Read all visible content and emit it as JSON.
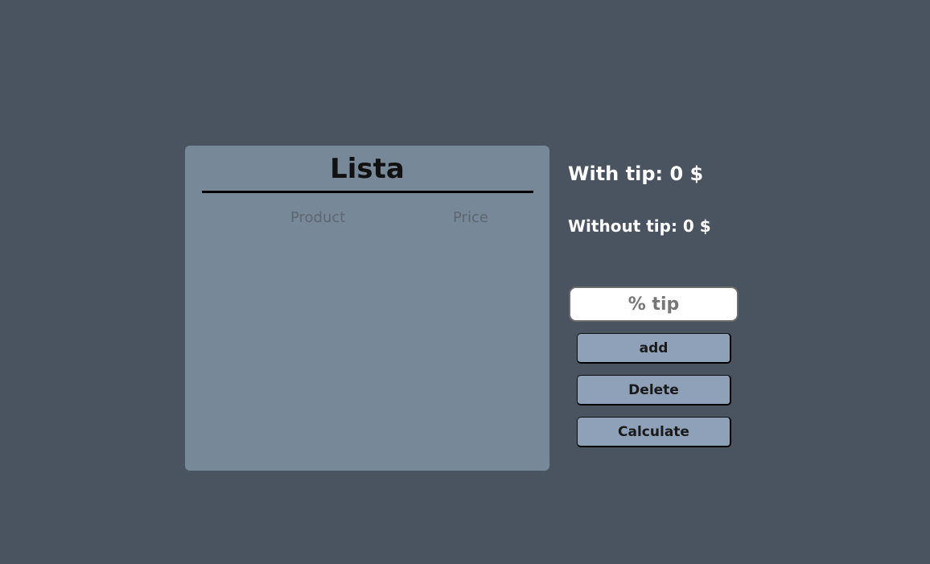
{
  "list": {
    "title": "Lista",
    "columns": {
      "product": "Product",
      "price": "Price"
    }
  },
  "totals": {
    "with_tip": "With tip: 0 $",
    "without_tip": "Without tip: 0 $"
  },
  "tip_input": {
    "value": "",
    "placeholder": "% tip"
  },
  "buttons": {
    "add": "add",
    "delete": "Delete",
    "calculate": "Calculate"
  },
  "colors": {
    "page_background": "#4a5360",
    "list_background": "#778899",
    "button_background": "#8fa1b8"
  }
}
